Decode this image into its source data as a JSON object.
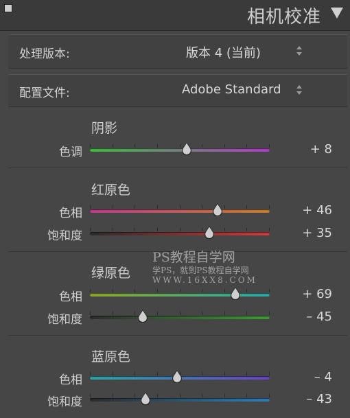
{
  "panel": {
    "title": "相机校准",
    "collapse_icon": "triangle-down-icon"
  },
  "process": {
    "label": "处理版本:",
    "value": "版本 4 (当前)"
  },
  "profile": {
    "label": "配置文件:",
    "value": "Adobe Standard"
  },
  "shadows": {
    "title": "阴影",
    "tint": {
      "label": "色调",
      "value": "+ 8",
      "level": 0.54
    }
  },
  "red_primary": {
    "title": "红原色",
    "hue": {
      "label": "色相",
      "value": "+ 46",
      "level": 0.71
    },
    "saturation": {
      "label": "饱和度",
      "value": "+ 35",
      "level": 0.665
    }
  },
  "green_primary": {
    "title": "绿原色",
    "hue": {
      "label": "色相",
      "value": "+ 69",
      "level": 0.81
    },
    "saturation": {
      "label": "饱和度",
      "value": "– 45",
      "level": 0.295
    }
  },
  "blue_primary": {
    "title": "蓝原色",
    "hue": {
      "label": "色相",
      "value": "– 4",
      "level": 0.485
    },
    "saturation": {
      "label": "饱和度",
      "value": "– 43",
      "level": 0.31
    }
  },
  "watermark": {
    "line1": "PS教程自学网",
    "line2": "学PS，就到PS教程自学网",
    "line3": "WWW.16XX8.COM"
  },
  "colors": {
    "tint": [
      "#3fbf3f",
      "#b23fc8"
    ],
    "red_hue": [
      "#c03a8f",
      "#c8802c"
    ],
    "red_sat": [
      "#2c2c2c",
      "#d23a3a"
    ],
    "green_hue": [
      "#8ca62c",
      "#2ca6a6"
    ],
    "green_sat": [
      "#2c2c2c",
      "#3f9a35"
    ],
    "blue_hue": [
      "#2ca6a6",
      "#6a44c0"
    ],
    "blue_sat": [
      "#2c2c2c",
      "#2d7fb8"
    ]
  }
}
